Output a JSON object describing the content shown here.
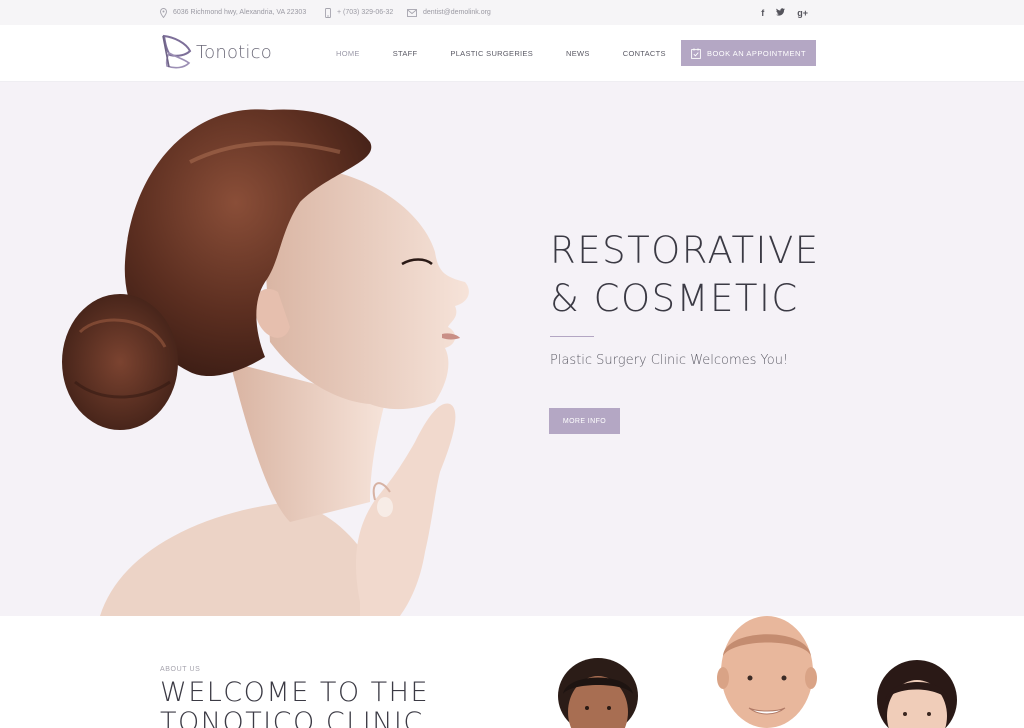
{
  "topbar": {
    "address": "6036 Richmond hwy, Alexandria, VA 22303",
    "phone": "+ (703) 329-06-32",
    "email": "dentist@demolink.org",
    "social": [
      "f",
      "t",
      "g+"
    ]
  },
  "header": {
    "logo_text": "Tonotico",
    "nav": [
      "HOME",
      "STAFF",
      "PLASTIC SURGERIES",
      "NEWS",
      "CONTACTS"
    ],
    "book_label": "BOOK AN APPOINTMENT"
  },
  "hero": {
    "title_line1": "RESTORATIVE",
    "title_line2": "& COSMETIC",
    "subtitle": "Plastic Surgery Clinic Welcomes You!",
    "button_label": "MORE INFO"
  },
  "about": {
    "eyebrow": "ABOUT US",
    "title_line1": "WELCOME TO THE",
    "title_line2": "TONOTICO CLINIC"
  },
  "colors": {
    "accent": "#b4a7c4",
    "hero_bg": "#f5f2f7",
    "topbar_bg": "#f6f5f7"
  }
}
